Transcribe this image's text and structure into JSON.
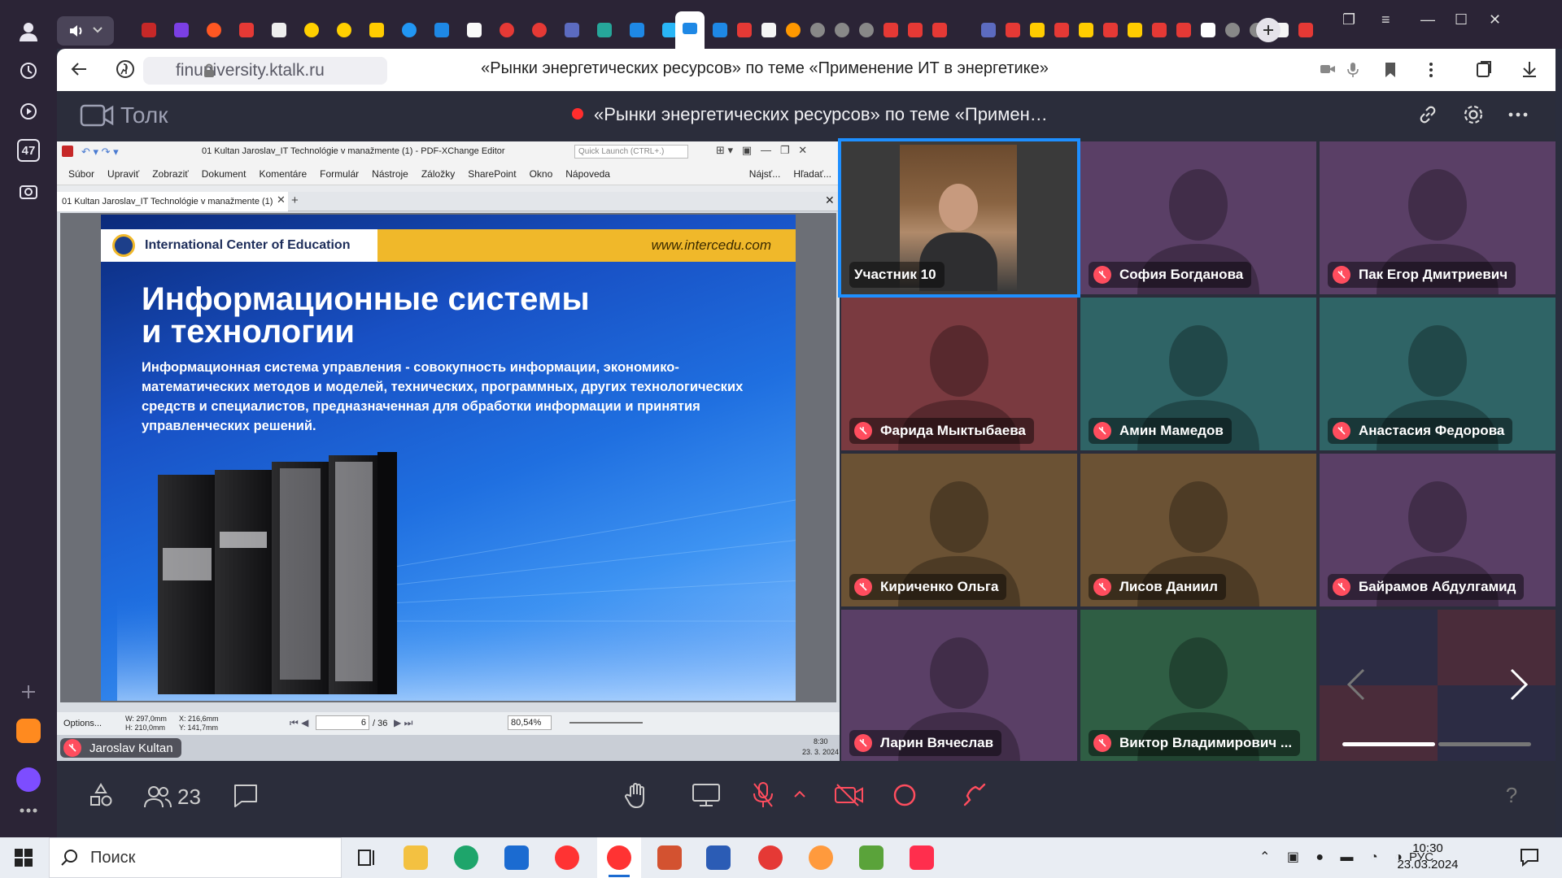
{
  "browser": {
    "url": "finuniversity.ktalk.ru",
    "page_title": "«Рынки энергетических ресурсов» по теме «Применение ИТ в энергетике»",
    "rail_badge": "47"
  },
  "app": {
    "name": "Толк",
    "meeting_title": "«Рынки энергетических ресурсов» по теме «Примен…",
    "participant_count": "23"
  },
  "share": {
    "window_title": "01 Kultan Jaroslav_IT Technológie v manažmente (1) - PDF-XChange Editor",
    "quick_launch": "Quick Launch (CTRL+.)",
    "menu": [
      "Súbor",
      "Upraviť",
      "Zobraziť",
      "Dokument",
      "Komentáre",
      "Formulár",
      "Nástroje",
      "Záložky",
      "SharePoint",
      "Okno",
      "Nápoveda"
    ],
    "find_label": "Nájsť...",
    "search_label": "Hľadať...",
    "tab_label": "01 Kultan Jaroslav_IT Technológie v manažmente (1)",
    "slide": {
      "org": "International Center of Education",
      "url": "www.intercedu.com",
      "title_line1": "Информационные системы",
      "title_line2": "и технологии",
      "body": "Информационная система управления - совокупность информации, экономико-математических методов и моделей, технических, программных, других технологических средств и специалистов, предназначенная для обработки информации и принятия управленческих решений."
    },
    "status": {
      "options": "Options...",
      "dims_w": "W: 297,0mm",
      "dims_h": "H: 210,0mm",
      "coord_x": "X: 216,6mm",
      "coord_y": "Y: 141,7mm",
      "page": "6",
      "page_total": "/ 36",
      "zoom": "80,54%"
    },
    "presenter": "Jaroslav Kultan",
    "share_clock_time": "8:30",
    "share_clock_date": "23. 3. 2024"
  },
  "participants": [
    {
      "name": "Участник 10",
      "muted": false,
      "video": true,
      "color": "#3a3a3a",
      "active": true
    },
    {
      "name": "София Богданова",
      "muted": true,
      "color": "#5a3f66"
    },
    {
      "name": "Пак Егор Дмитриевич",
      "muted": true,
      "color": "#5a3f66"
    },
    {
      "name": "Фарида Мыктыбаева",
      "muted": true,
      "color": "#7a3a40"
    },
    {
      "name": "Амин Мамедов",
      "muted": true,
      "color": "#2f6466"
    },
    {
      "name": "Анастасия Федорова",
      "muted": true,
      "color": "#2f6466"
    },
    {
      "name": "Кириченко Ольга",
      "muted": true,
      "color": "#6b5234"
    },
    {
      "name": "Лисов Даниил",
      "muted": true,
      "color": "#6b5234"
    },
    {
      "name": "Байрамов Абдулгамид",
      "muted": true,
      "color": "#5a3f66"
    },
    {
      "name": "Ларин Вячеслав",
      "muted": true,
      "color": "#5a3f66"
    },
    {
      "name": "Виктор Владимирович ...",
      "muted": true,
      "color": "#2f5e44"
    }
  ],
  "taskbar": {
    "search_placeholder": "Поиск",
    "lang": "РУС",
    "time": "10:30",
    "date": "23.03.2024"
  }
}
